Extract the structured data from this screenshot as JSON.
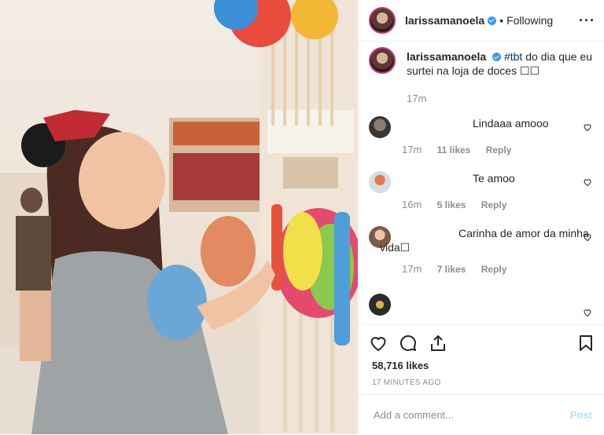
{
  "post_header": {
    "username": "larissamanoela",
    "separator": "•",
    "follow_status": "Following",
    "more_icon": "more-horizontal-icon"
  },
  "caption": {
    "username": "larissamanoela",
    "hashtag": "#tbt",
    "text": " do dia que eu surtei na loja de doces ☐☐",
    "time": "17m"
  },
  "comments": [
    {
      "text": "Lindaaa amooo",
      "time": "17m",
      "likes": "11 likes",
      "reply": "Reply"
    },
    {
      "text": "Te amoo",
      "time": "16m",
      "likes": "5 likes",
      "reply": "Reply"
    },
    {
      "text": "Carinha de amor da minha vida☐",
      "time": "17m",
      "likes": "7 likes",
      "reply": "Reply"
    },
    {
      "text": "",
      "time": "",
      "likes": "",
      "reply": ""
    }
  ],
  "actions": {
    "icons": [
      "heart-icon",
      "comment-icon",
      "share-icon",
      "bookmark-icon"
    ]
  },
  "likes_count": "58,716 likes",
  "time_ago": "17 MINUTES AGO",
  "add_comment": {
    "placeholder": "Add a comment...",
    "post_label": "Post"
  },
  "colors": {
    "verified": "#3897f0",
    "hashtag": "#003569",
    "post_disabled": "#b2dffc",
    "secondary_text": "#8e8e8e"
  }
}
